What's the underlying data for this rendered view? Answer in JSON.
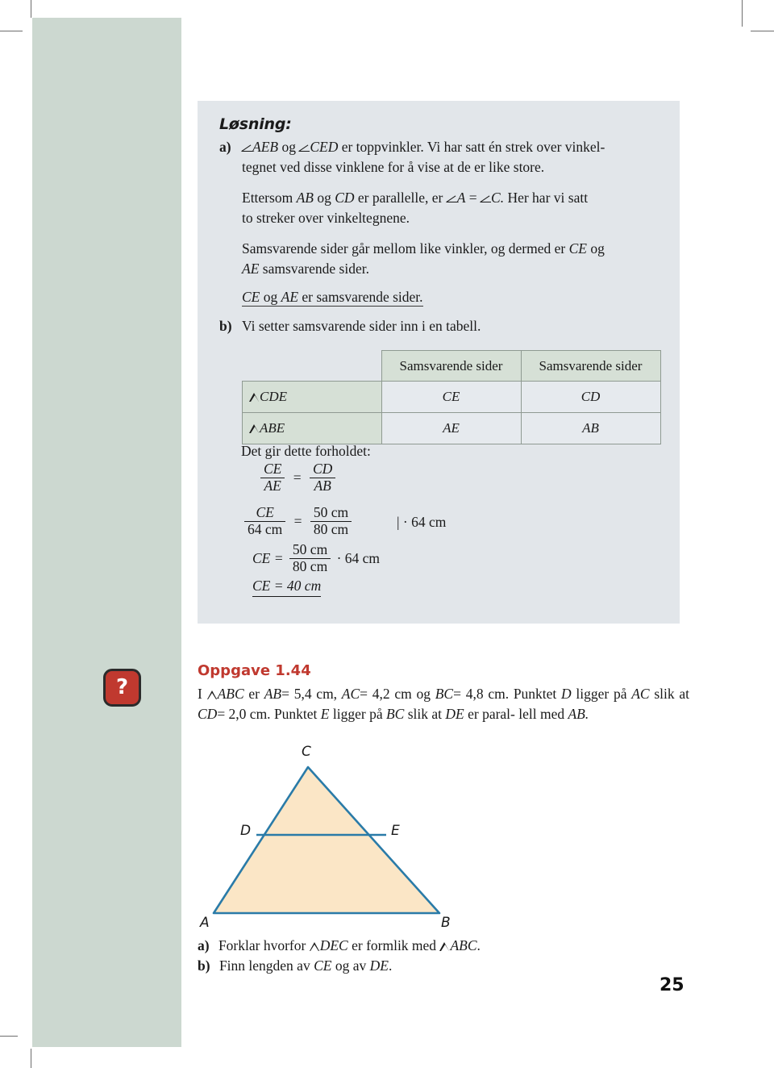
{
  "page": {
    "number": "25"
  },
  "solution": {
    "heading": "Løsning:",
    "items": [
      {
        "marker": "a)",
        "lines": [
          "AEB og",
          "CED er toppvinkler. Vi har satt én strek over vinkel-",
          "tegnet ved disse vinklene for å vise at de er like store."
        ]
      }
    ],
    "para_a_pre": "",
    "para_a_l1_mid": "og",
    "para_a_l1_tail": "er toppvinkler. Vi har satt én strek over vinkel-",
    "para_a_l2": "tegnet ved disse vinklene for å vise at de er like store.",
    "para_b_l1_a": "Ettersom",
    "para_b_l1_ab": "AB",
    "para_b_l1_og": "og",
    "para_b_l1_cd": "CD",
    "para_b_l1_b": "er parallelle, er",
    "para_b_l1_angA": "A",
    "para_b_l1_eq": "=",
    "para_b_l1_angC": "C.",
    "para_b_l1_c": "Her har vi satt",
    "para_b_l2": "to streker over vinkeltegnene.",
    "para_c_l1": "Samsvarende sider går mellom like vinkler, og dermed er",
    "para_c_ce": "CE",
    "para_c_og": "og",
    "para_c_l2_ae": "AE",
    "para_c_l2_rest": "samsvarende sider.",
    "conclusion_ce": "CE",
    "conclusion_og": "og",
    "conclusion_ae": "AE",
    "conclusion_rest": "er samsvarende sider.",
    "marker_a": "a)",
    "marker_b": "b)",
    "para_d": "Vi setter samsvarende sider inn i en tabell.",
    "eq_intro": "Det gir dette forholdet:",
    "angle_aeb": "AEB",
    "angle_ced": "CED"
  },
  "table": {
    "corner": "",
    "headers": [
      "Samsvarende sider",
      "Samsvarende sider"
    ],
    "rows": [
      {
        "label": "CDE",
        "cells": [
          "CE",
          "CD"
        ]
      },
      {
        "label": "ABE",
        "cells": [
          "AE",
          "AB"
        ]
      }
    ]
  },
  "equations": {
    "eq1": {
      "lhs_num": "CE",
      "lhs_den": "AE",
      "sign": "=",
      "rhs_num": "CD",
      "rhs_den": "AB"
    },
    "eq2": {
      "lhs_num": "CE",
      "lhs_den": "64 cm",
      "sign": "=",
      "rhs_num": "50 cm",
      "rhs_den": "80 cm",
      "marker": "| · 64 cm"
    },
    "eq3": {
      "lhs": "CE =",
      "num": "50 cm",
      "den": "80 cm",
      "tail": "· 64 cm"
    },
    "eq4": {
      "text": "CE = 40 cm"
    }
  },
  "exercise": {
    "icon_glyph": "?",
    "title": "Oppgave 1.44",
    "body_l1_a": "I",
    "body_l1_abc": "ABC",
    "body_l1_b": "er",
    "body_l1_ab": "AB",
    "body_l1_ab_val": "= 5,4 cm,",
    "body_l1_ac": "AC",
    "body_l1_ac_val": "= 4,2 cm",
    "body_l1_og": "og",
    "body_l1_bc": "BC",
    "body_l1_bc_val": "= 4,8 cm.",
    "body_l1_c": "Punktet",
    "body_l1_d": "D",
    "body_l1_e": "ligger",
    "body_l2_a": "på",
    "body_l2_ac": "AC",
    "body_l2_b": "slik at",
    "body_l2_cd": "CD",
    "body_l2_cd_val": "= 2,0 cm.",
    "body_l2_c": "Punktet",
    "body_l2_e": "E",
    "body_l2_d": "ligger på",
    "body_l2_bc": "BC",
    "body_l2_f": "slik at",
    "body_l2_de": "DE",
    "body_l2_g": "er paral-",
    "body_l3_a": "lell med",
    "body_l3_ab": "AB.",
    "subquestions": [
      {
        "label": "a)",
        "pre": "Forklar hvorfor",
        "tri1": "DEC",
        "mid": "er formlik med",
        "tri2": "ABC",
        "post": "."
      },
      {
        "label": "b)",
        "pre": "Finn lengden av",
        "it1": "CE",
        "mid": "og av",
        "it2": "DE",
        "post": "."
      }
    ]
  },
  "figure": {
    "labels": {
      "A": "A",
      "B": "B",
      "C": "C",
      "D": "D",
      "E": "E"
    },
    "stroke_color": "#2a7ba8",
    "fill_color": "#fbe6c6"
  },
  "colors": {
    "sidebar_green": "#ccd8d0",
    "solution_panel": "#e2e6ea",
    "table_header_green": "#d6e0d6",
    "table_cell": "#e6eaee",
    "accent_red": "#c0392f"
  }
}
